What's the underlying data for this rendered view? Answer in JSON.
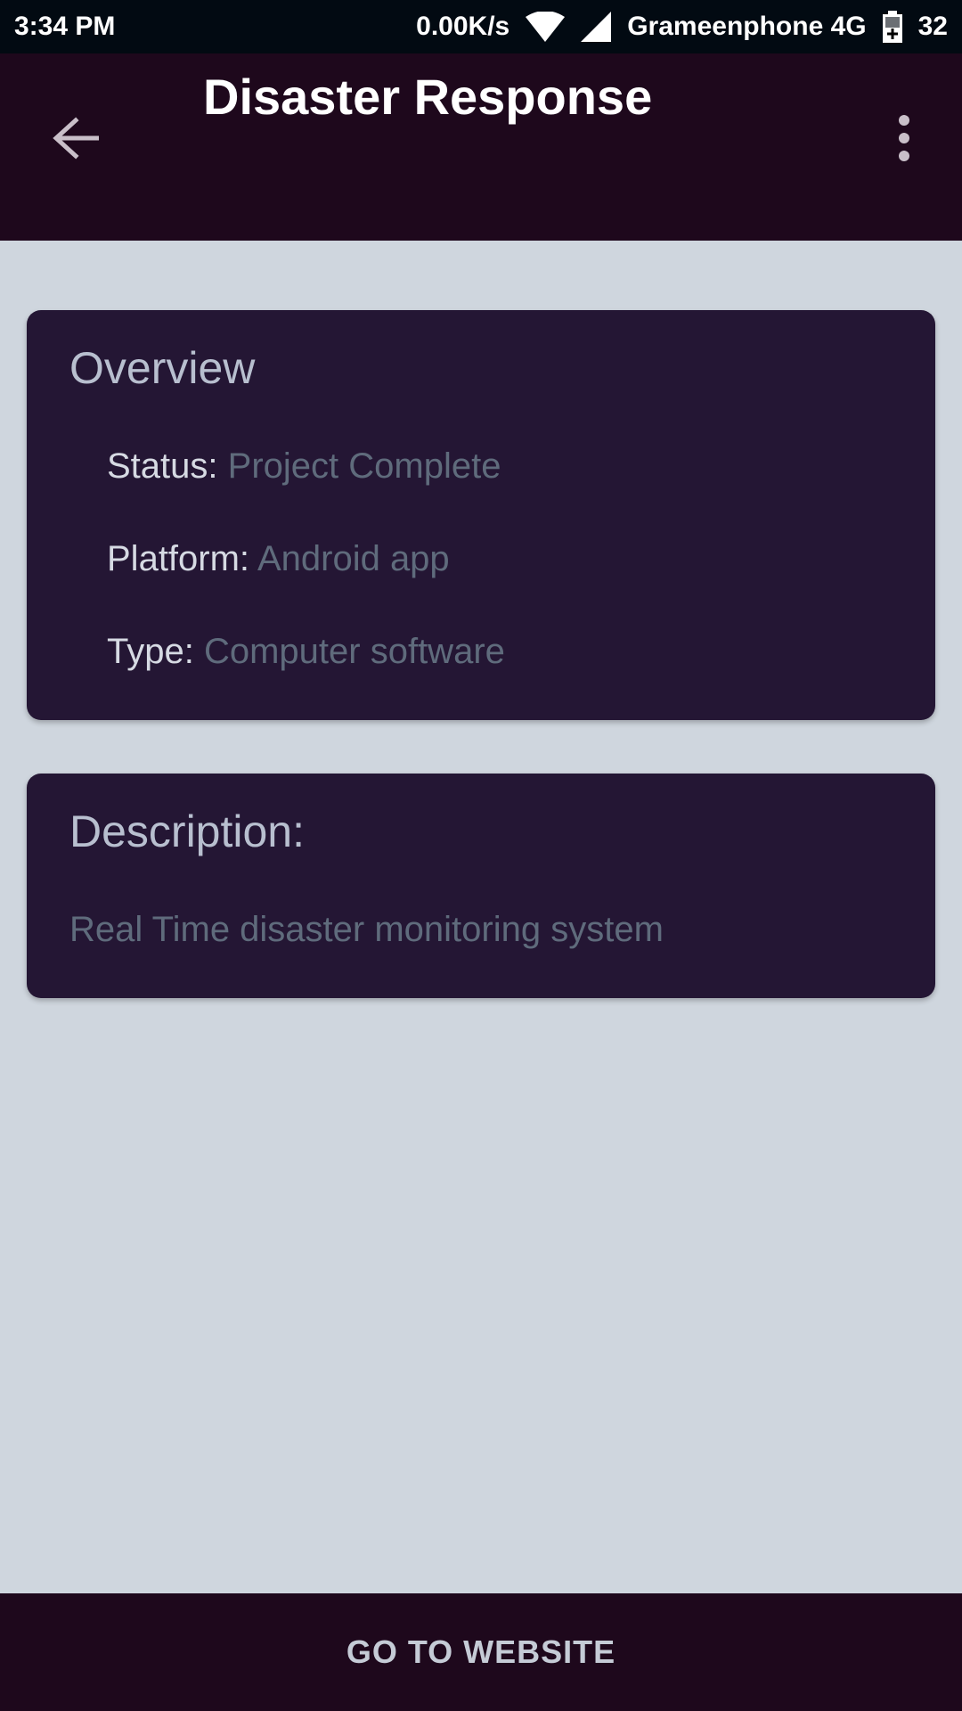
{
  "status_bar": {
    "time": "3:34 PM",
    "network_speed": "0.00K/s",
    "carrier": "Grameenphone 4G",
    "battery": "32",
    "icons": [
      "wifi-icon",
      "signal-icon",
      "battery-icon"
    ]
  },
  "app_bar": {
    "title": "Disaster Response",
    "back_icon": "arrow-back-icon",
    "menu_icon": "more-vert-icon"
  },
  "overview": {
    "heading": "Overview",
    "status_label": "Status:",
    "status_value": "Project Complete",
    "platform_label": "Platform:",
    "platform_value": "Android app",
    "type_label": "Type:",
    "type_value": "Computer software"
  },
  "description": {
    "heading": "Description:",
    "text": "Real Time disaster monitoring system"
  },
  "bottom": {
    "button_label": "GO TO WEBSITE"
  },
  "colors": {
    "app_bar": "#1e081c",
    "card": "#241634",
    "background": "#cfd6de",
    "value_text": "#5f6b7c"
  }
}
